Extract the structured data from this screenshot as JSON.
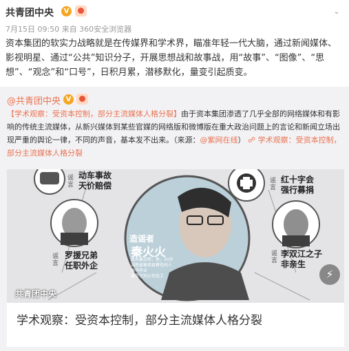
{
  "post": {
    "author": "共青团中央",
    "verified_badge": "V",
    "meta": "7月15日 09:50 来自 360安全浏览器",
    "text": "资本集团的软实力战略就是在传媒界和学术界，瞄准年轻一代大脑，通过新闻媒体、影视明星、通过“公共”知识分子，开展思想战和故事战，用“故事”、“图像”、“思想”、“观念”和“口号”，日积月累，潜移默化，量变引起质变。"
  },
  "repost": {
    "author": "@共青团中央",
    "verified_badge": "V",
    "title_tag": "【学术观察：受资本控制，部分主流媒体人格分裂】",
    "body": "由于资本集团渗透了几乎全部的网络媒体和有影响的传统主流媒体，从新兴媒体到某些官媒的网络版和微博版在重大政治问题上的言论和新闻立场出现严重的舆论一律，不同的声音，基本发不出来。（来源：",
    "source_link": "@紫网在线",
    "source_close": "）",
    "link_icon": "link-icon",
    "article_link": "学术观察：受资本控制，部分主流媒体人格分裂",
    "card": {
      "image_caption_top": "动车事故\n天价赔偿",
      "rumor_label_top": "谣言",
      "redcross_caption": "红十字会\n强行募捐",
      "rumor_label_redcross": "谣言",
      "rumor_label_left": "谣言",
      "left_caption": "罗援兄弟\n任职外企",
      "center_label": "造谣者",
      "center_name": "秦火火",
      "center_details": "真名秦志晖，男，30岁\n湖南省衡南县春花村人\n高中毕业\n曾是尔玛公司员工",
      "rumor_label_right": "谣言",
      "right_caption": "李双江之子\n非亲生",
      "watermark": "共青团中央",
      "title": "学术观察：受资本控制，部分主流媒体人格分裂"
    }
  },
  "colors": {
    "accent": "#eb7350",
    "meta": "#999999",
    "repost_bg": "#f2f2f5",
    "badge": "#f5a623"
  }
}
